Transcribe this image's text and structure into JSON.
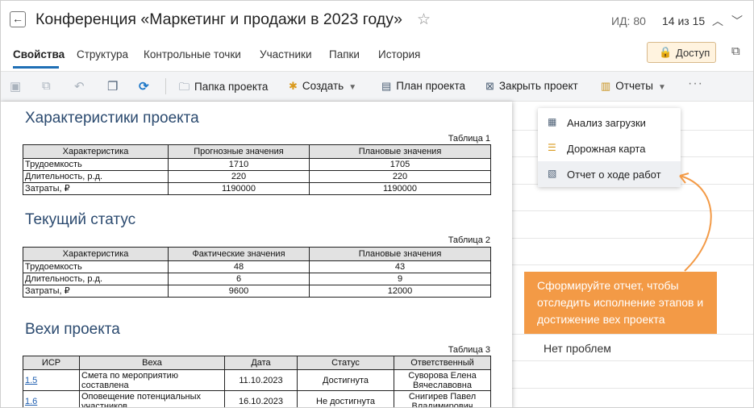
{
  "header": {
    "title": "Конференция «Маркетинг и продажи в 2023 году»",
    "id_label": "ИД: 80",
    "counter": "14 из 15"
  },
  "tabs": [
    {
      "label": "Свойства",
      "active": true
    },
    {
      "label": "Структура"
    },
    {
      "label": "Контрольные точки"
    },
    {
      "label": "Участники"
    },
    {
      "label": "Папки"
    },
    {
      "label": "История"
    }
  ],
  "access_button": "Доступ",
  "toolbar": {
    "project_folder": "Папка проекта",
    "create": "Создать",
    "project_plan": "План проекта",
    "close_project": "Закрыть проект",
    "reports": "Отчеты"
  },
  "reports_menu": [
    {
      "label": "Анализ загрузки",
      "icon": "table-icon"
    },
    {
      "label": "Дорожная карта",
      "icon": "roadmap-icon"
    },
    {
      "label": "Отчет о ходе работ",
      "icon": "progress-report-icon",
      "highlighted": true
    }
  ],
  "callout": "Сформируйте отчет, чтобы отследить исполнение этапов и достижение вех проекта",
  "right_panel": {
    "no_problems": "Нет проблем"
  },
  "document": {
    "section1": {
      "heading": "Характеристики проекта",
      "caption": "Таблица 1",
      "headers": [
        "Характеристика",
        "Прогнозные значения",
        "Плановые значения"
      ],
      "rows": [
        [
          "Трудоемкость",
          "1710",
          "1705"
        ],
        [
          "Длительность, р.д.",
          "220",
          "220"
        ],
        [
          "Затраты, ₽",
          "1190000",
          "1190000"
        ]
      ]
    },
    "section2": {
      "heading": "Текущий статус",
      "caption": "Таблица 2",
      "headers": [
        "Характеристика",
        "Фактические значения",
        "Плановые значения"
      ],
      "rows": [
        [
          "Трудоемкость",
          "48",
          "43"
        ],
        [
          "Длительность, р.д.",
          "6",
          "9"
        ],
        [
          "Затраты, ₽",
          "9600",
          "12000"
        ]
      ]
    },
    "section3": {
      "heading": "Вехи проекта",
      "caption": "Таблица 3",
      "headers": [
        "ИСР",
        "Веха",
        "Дата",
        "Статус",
        "Ответственный"
      ],
      "rows": [
        [
          "1.5",
          "Смета по мероприятию составлена",
          "11.10.2023",
          "Достигнута",
          "Суворова Елена Вячеславовна"
        ],
        [
          "1.6",
          "Оповещение потенциальных участников",
          "16.10.2023",
          "Не достигнута",
          "Снигирев Павел Владимирович"
        ]
      ]
    }
  },
  "colors": {
    "accent": "#1f6fb5",
    "callout": "#f39a46",
    "heading": "#2b4a6f"
  }
}
